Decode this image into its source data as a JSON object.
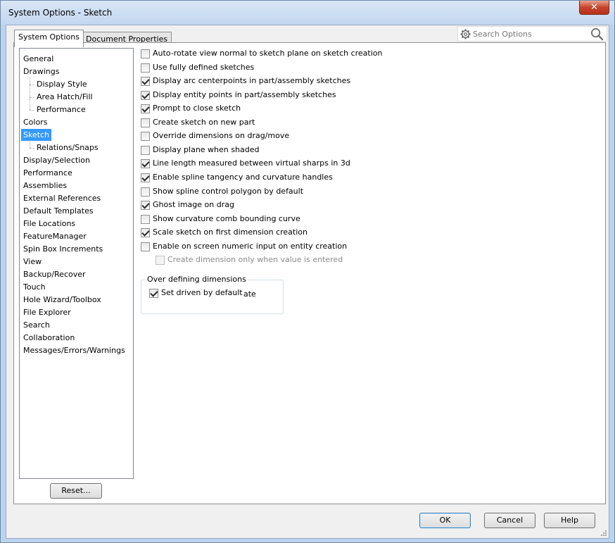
{
  "window": {
    "title": "System Options - Sketch",
    "close_symbol": "✕"
  },
  "tabs": [
    {
      "label": "System Options",
      "active": true
    },
    {
      "label": "Document Properties",
      "active": false
    }
  ],
  "search": {
    "placeholder": "Search Options"
  },
  "tree": [
    {
      "label": "General",
      "level": 0
    },
    {
      "label": "Drawings",
      "level": 0
    },
    {
      "label": "Display Style",
      "level": 1
    },
    {
      "label": "Area Hatch/Fill",
      "level": 1
    },
    {
      "label": "Performance",
      "level": 1
    },
    {
      "label": "Colors",
      "level": 0
    },
    {
      "label": "Sketch",
      "level": 0,
      "selected": true
    },
    {
      "label": "Relations/Snaps",
      "level": 1
    },
    {
      "label": "Display/Selection",
      "level": 0
    },
    {
      "label": "Performance",
      "level": 0
    },
    {
      "label": "Assemblies",
      "level": 0
    },
    {
      "label": "External References",
      "level": 0
    },
    {
      "label": "Default Templates",
      "level": 0
    },
    {
      "label": "File Locations",
      "level": 0
    },
    {
      "label": "FeatureManager",
      "level": 0
    },
    {
      "label": "Spin Box Increments",
      "level": 0
    },
    {
      "label": "View",
      "level": 0
    },
    {
      "label": "Backup/Recover",
      "level": 0
    },
    {
      "label": "Touch",
      "level": 0
    },
    {
      "label": "Hole Wizard/Toolbox",
      "level": 0
    },
    {
      "label": "File Explorer",
      "level": 0
    },
    {
      "label": "Search",
      "level": 0
    },
    {
      "label": "Collaboration",
      "level": 0
    },
    {
      "label": "Messages/Errors/Warnings",
      "level": 0
    }
  ],
  "reset_label": "Reset...",
  "options": [
    {
      "label": "Auto-rotate view normal to sketch plane on sketch creation",
      "checked": false
    },
    {
      "label": "Use fully defined sketches",
      "checked": false
    },
    {
      "label": "Display arc centerpoints in part/assembly sketches",
      "checked": true
    },
    {
      "label": "Display entity points in part/assembly sketches",
      "checked": true
    },
    {
      "label": "Prompt to close sketch",
      "checked": true
    },
    {
      "label": "Create sketch on new part",
      "checked": false
    },
    {
      "label": "Override dimensions on drag/move",
      "checked": false
    },
    {
      "label": "Display plane when shaded",
      "checked": false
    },
    {
      "label": "Line length measured between virtual sharps in 3d",
      "checked": true
    },
    {
      "label": "Enable spline tangency and curvature handles",
      "checked": true
    },
    {
      "label": "Show spline control polygon by default",
      "checked": false
    },
    {
      "label": "Ghost image on drag",
      "checked": true
    },
    {
      "label": "Show curvature comb bounding curve",
      "checked": false
    },
    {
      "label": "Scale sketch on first dimension creation",
      "checked": true
    },
    {
      "label": "Enable on screen numeric input on entity creation",
      "checked": false
    },
    {
      "label": "Create dimension only when value is entered",
      "checked": false,
      "disabled": true,
      "indent": true
    }
  ],
  "over_defining": {
    "title": "Over defining dimensions",
    "option_label": "Set driven by default",
    "option_checked": true,
    "ghost_text": "ate"
  },
  "buttons": {
    "ok": "OK",
    "cancel": "Cancel",
    "help": "Help"
  }
}
